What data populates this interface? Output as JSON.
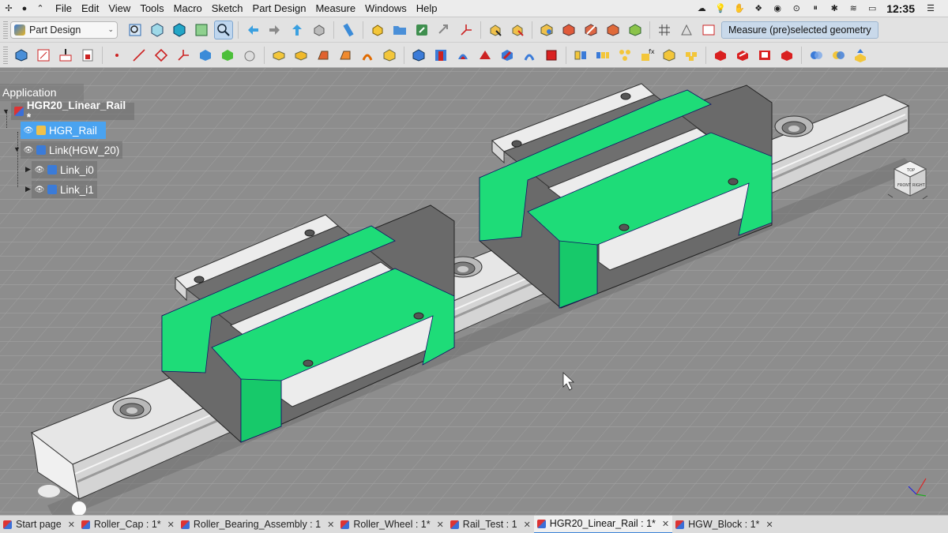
{
  "menubar": {
    "items": [
      "File",
      "Edit",
      "View",
      "Tools",
      "Macro",
      "Sketch",
      "Part Design",
      "Measure",
      "Windows",
      "Help"
    ],
    "clock": "12:35"
  },
  "toolbar": {
    "workbench": "Part Design",
    "measure_label": "Measure (pre)selected geometry"
  },
  "tree": {
    "header": "Application",
    "document": "HGR20_Linear_Rail *",
    "items": [
      {
        "label": "HGR_Rail",
        "selected": true
      },
      {
        "label": "Link(HGW_20)",
        "selected": false
      },
      {
        "label": "Link_i0",
        "selected": false
      },
      {
        "label": "Link_i1",
        "selected": false
      }
    ]
  },
  "navcube": {
    "face_top": "TOP",
    "face_front": "FRONT",
    "face_right": "RIGHT"
  },
  "tabs": [
    {
      "label": "Start page",
      "active": false
    },
    {
      "label": "Roller_Cap : 1*",
      "active": false
    },
    {
      "label": "Roller_Bearing_Assembly : 1",
      "active": false
    },
    {
      "label": "Roller_Wheel : 1*",
      "active": false
    },
    {
      "label": "Rail_Test : 1",
      "active": false
    },
    {
      "label": "HGR20_Linear_Rail : 1*",
      "active": true
    },
    {
      "label": "HGW_Block : 1*",
      "active": false
    }
  ],
  "colors": {
    "accent": "#3b82d6",
    "seal_green": "#1edc78",
    "block_gray": "#6e6e6e",
    "rail_light": "#e3e3e3",
    "selection": "#4aa3f0"
  }
}
